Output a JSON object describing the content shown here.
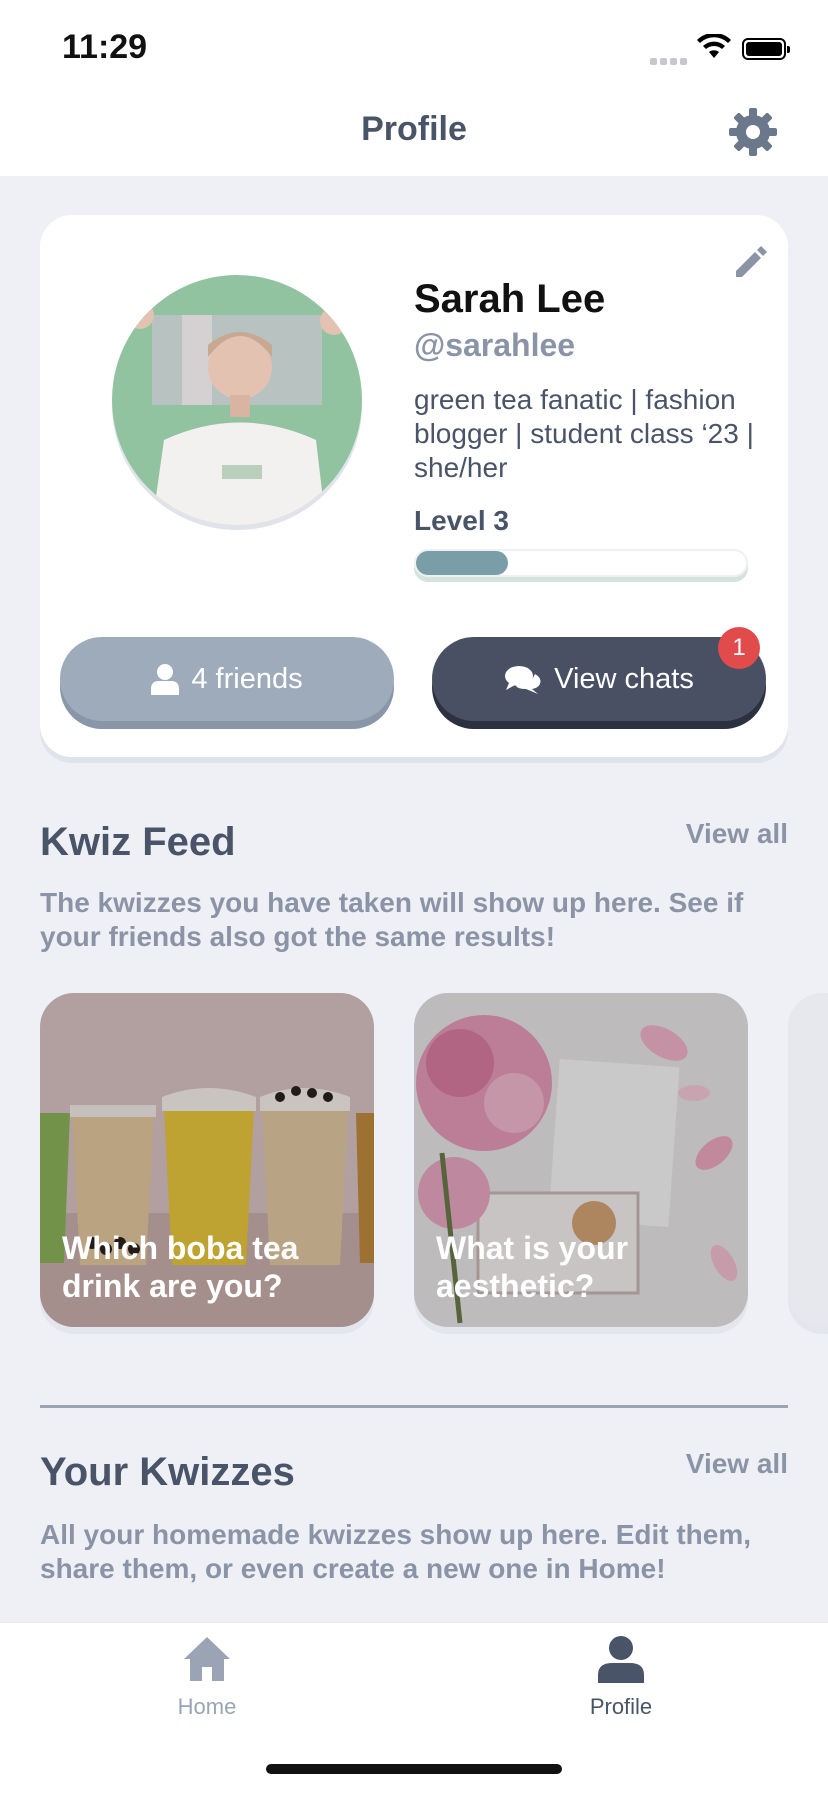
{
  "status_bar": {
    "time": "11:29"
  },
  "header": {
    "title": "Profile"
  },
  "profile": {
    "name": "Sarah Lee",
    "handle": "@sarahlee",
    "bio": "green tea fanatic | fashion blogger | student class ‘23 | she/her",
    "level_label": "Level 3",
    "level_progress": 0.28,
    "friends_label": "4 friends",
    "chats_label": "View chats",
    "chats_badge": "1"
  },
  "kwiz_feed": {
    "title": "Kwiz Feed",
    "view_all": "View all",
    "description": "The kwizzes you have taken will show up here. See if your friends also got the same results!",
    "cards": [
      {
        "title": "Which boba tea drink are you?"
      },
      {
        "title": "What is your aesthetic?"
      }
    ]
  },
  "your_kwizzes": {
    "title": "Your Kwizzes",
    "view_all": "View all",
    "description": "All your homemade kwizzes show up here. Edit them, share them, or even create a new one in Home!"
  },
  "tabs": [
    {
      "label": "Home",
      "icon": "home-icon",
      "active": false
    },
    {
      "label": "Profile",
      "icon": "person-icon",
      "active": true
    }
  ],
  "colors": {
    "accent_dark": "#4a5063",
    "muted": "#8a94a6",
    "badge": "#e24b4b",
    "progress": "#7a9ea7"
  }
}
